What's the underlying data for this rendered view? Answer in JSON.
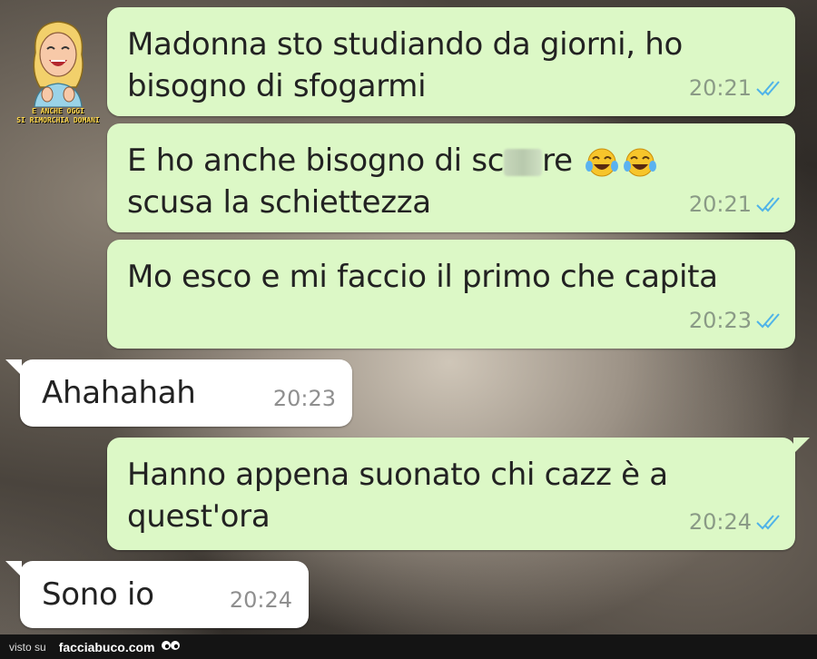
{
  "messages": [
    {
      "direction": "outgoing",
      "lines": [
        "Madonna sto studiando da giorni, ho",
        "bisogno di sfogarmi"
      ],
      "time": "20:21",
      "status": "read"
    },
    {
      "direction": "outgoing",
      "line1_prefix": "E ho anche bisogno di sc",
      "line1_suffix": "re",
      "line2": "scusa la schiettezza",
      "emoji": "face-with-tears-of-joy x2",
      "time": "20:21",
      "status": "read"
    },
    {
      "direction": "outgoing",
      "lines": [
        "Mo esco e mi faccio il primo che capita"
      ],
      "time": "20:23",
      "status": "read"
    },
    {
      "direction": "incoming",
      "lines": [
        "Ahahahah"
      ],
      "time": "20:23"
    },
    {
      "direction": "outgoing",
      "lines": [
        "Hanno appena suonato chi cazz è a",
        "quest'ora"
      ],
      "time": "20:24",
      "status": "read"
    },
    {
      "direction": "incoming",
      "lines": [
        "Sono io"
      ],
      "time": "20:24"
    }
  ],
  "avatar": {
    "caption_line1": "E ANCHE OGGI",
    "caption_line2": "SI RIMORCHIA DOMANI"
  },
  "footer": {
    "visto_label": "visto su",
    "site_label": "facciabuco.com"
  },
  "colors": {
    "outgoing_bubble": "#dcf8c6",
    "incoming_bubble": "#ffffff",
    "read_ticks": "#4fb3e8",
    "footer_bg": "#141414"
  }
}
